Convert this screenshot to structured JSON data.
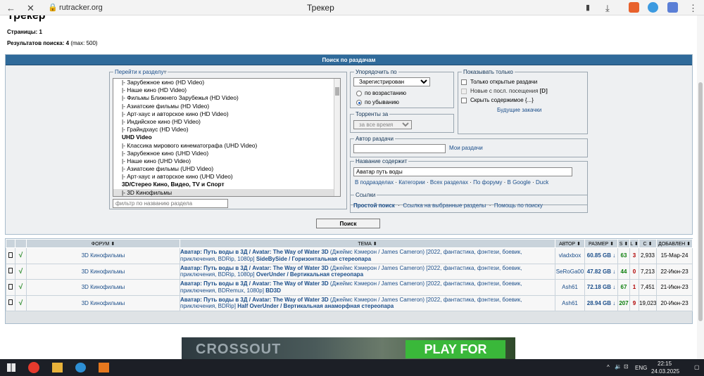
{
  "browser": {
    "url": "rutracker.org",
    "title": "Трекер"
  },
  "page": {
    "heading": "Трекер",
    "pages_label": "Страницы:",
    "pages_value": "1",
    "results_label": "Результатов поиска:",
    "results_count": "4",
    "results_max": "(max: 500)"
  },
  "search": {
    "panel_title": "Поиск по раздачам",
    "forum_legend": "Перейти к разделу",
    "forum_options": [
      {
        "label": "|- Зарубежное кино (HD Video)",
        "bold": false
      },
      {
        "label": "|- Наше кино (HD Video)",
        "bold": false
      },
      {
        "label": "|- Фильмы Ближнего Зарубежья (HD Video)",
        "bold": false
      },
      {
        "label": "|- Азиатские фильмы (HD Video)",
        "bold": false
      },
      {
        "label": "|- Арт-хаус и авторское кино (HD Video)",
        "bold": false
      },
      {
        "label": "|- Индийское кино (HD Video)",
        "bold": false
      },
      {
        "label": "|- Грайндхаус (HD Video)",
        "bold": false
      },
      {
        "label": "UHD Video",
        "bold": true
      },
      {
        "label": "|- Классика мирового кинематографа (UHD Video)",
        "bold": false
      },
      {
        "label": "|- Зарубежное кино (UHD Video)",
        "bold": false
      },
      {
        "label": "|- Наше кино (UHD Video)",
        "bold": false
      },
      {
        "label": "|- Азиатские фильмы (UHD Video)",
        "bold": false
      },
      {
        "label": "|- Арт-хаус и авторское кино (UHD Video)",
        "bold": false
      },
      {
        "label": "3D/Стерео Кино, Видео, TV и Спорт",
        "bold": true
      },
      {
        "label": "|- 3D Кинофильмы",
        "bold": false
      }
    ],
    "forum_filter_placeholder": "фильтр по названию раздела",
    "sort_legend": "Упорядочить по",
    "sort_value": "Зарегистрирован",
    "sort_asc": "по возрастанию",
    "sort_desc": "по убыванию",
    "torrents_legend": "Торренты за",
    "torrents_value": "за все время",
    "show_legend": "Показывать только",
    "show_open": "Только открытые раздачи",
    "show_new": "Новые с посл. посещения",
    "show_new_icon": "[D]",
    "show_hide": "Скрыть содержимое",
    "show_hide_icon": "{...}",
    "future_downloads": "Будущие закачки",
    "author_legend": "Автор раздачи",
    "author_value": "",
    "my_torrents": "Мои раздачи",
    "title_legend": "Название содержит",
    "title_value": "Аватар путь воды",
    "title_links": [
      "В подразделах",
      "Категории",
      "Всех разделах",
      "По форуму",
      "В Google",
      "Duck"
    ],
    "links_legend": "Ссылки",
    "links": [
      "Простой поиск",
      "Ссылка на выбранные разделы",
      "Помощь по поиску"
    ],
    "search_button": "Поиск"
  },
  "results": {
    "headers": [
      "",
      "",
      "ФОРУМ",
      "ТЕМА",
      "АВТОР",
      "РАЗМЕР",
      "S",
      "L",
      "C",
      "ДОБАВЛЕН"
    ],
    "rows": [
      {
        "forum": "3D Кинофильмы",
        "title_bold": "Аватар: Путь воды в 3Д / Avatar: The Way of Water 3D",
        "title_rest": " (Джеймс Кэмерон / James Cameron) [2022, фантастика, фэнтези, боевик, приключения, BDRip, 1080p] ",
        "title_tail": "SideBySide / Горизонтальная стереопара",
        "author": "vladxbox",
        "size": "60.85 GB ↓",
        "seeds": "63",
        "leechs": "3",
        "completed": "2,933",
        "added": "15-Мар-24"
      },
      {
        "forum": "3D Кинофильмы",
        "title_bold": "Аватар: Путь воды в 3Д / Avatar: The Way of Water 3D",
        "title_rest": " (Джеймс Кэмерон / James Cameron) [2022, фантастика, фэнтези, боевик, приключения, BDRip, 1080p] ",
        "title_tail": "OverUnder / Вертикальная стереопара",
        "author": "SeRoGa00",
        "size": "47.82 GB ↓",
        "seeds": "44",
        "leechs": "0",
        "completed": "7,213",
        "added": "22-Июн-23"
      },
      {
        "forum": "3D Кинофильмы",
        "title_bold": "Аватар: Путь воды в 3Д / Avatar: The Way of Water 3D",
        "title_rest": " (Джеймс Кэмерон / James Cameron) [2022, фантастика, фэнтези, боевик, приключения, BDRemux, 1080p] ",
        "title_tail": "BD3D",
        "author": "Ash61",
        "size": "72.18 GB ↓",
        "seeds": "67",
        "leechs": "1",
        "completed": "7,451",
        "added": "21-Июн-23"
      },
      {
        "forum": "3D Кинофильмы",
        "title_bold": "Аватар: Путь воды в 3Д / Avatar: The Way of Water 3D",
        "title_rest": " (Джеймс Кэмерон / James Cameron) [2022, фантастика, фэнтези, боевик, приключения, BDRip] ",
        "title_tail": "Half OverUnder / Вертикальная анаморфная стереопара",
        "author": "Ash61",
        "size": "28.94 GB ↓",
        "seeds": "207",
        "leechs": "9",
        "completed": "19,023",
        "added": "20-Июн-23"
      }
    ]
  },
  "banner": {
    "brand": "CROSSOUT",
    "cta": "PLAY FOR"
  },
  "taskbar": {
    "lang": "ENG",
    "time": "22:15",
    "date": "24.03.2025"
  }
}
